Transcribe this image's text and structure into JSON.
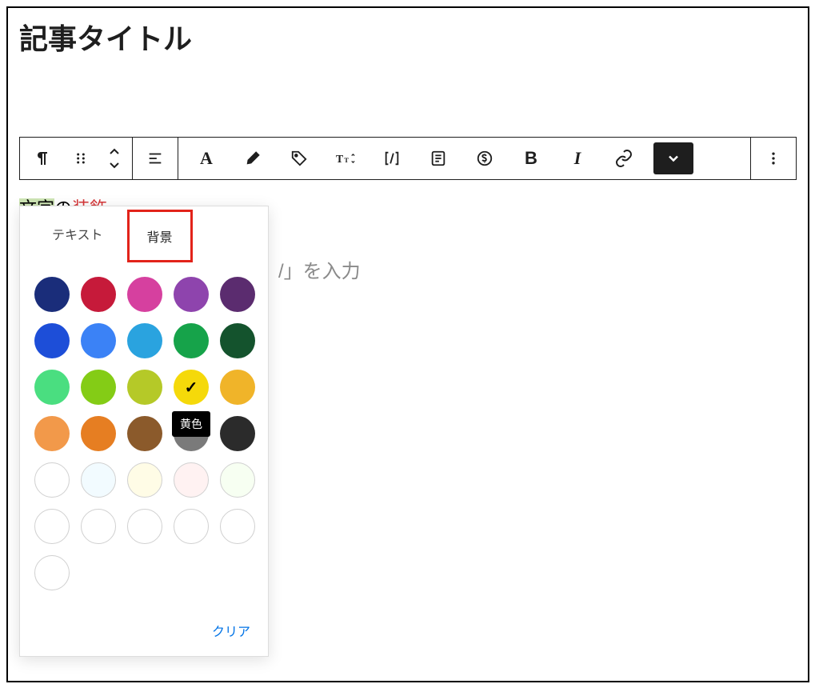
{
  "title": "記事タイトル",
  "content": {
    "highlighted": "文字",
    "plain1": "の",
    "red": "装飾"
  },
  "placeholder_fragment": "/」を入力",
  "popover": {
    "tabs": {
      "text": "テキスト",
      "background": "背景"
    },
    "tooltip": "黄色",
    "clear": "クリア",
    "colors_row1": [
      "#1a2d7a",
      "#c61a3a",
      "#d6409f",
      "#8e44ad",
      "#5b2c6f"
    ],
    "colors_row2": [
      "#1d4ed8",
      "#3b82f6",
      "#2aa3df",
      "#16a34a",
      "#14532d"
    ],
    "colors_row3": [
      "#4ade80",
      "#84cc16",
      "#b5c928",
      "#f5d90a",
      "#f0b429"
    ],
    "colors_row4": [
      "#f2994a",
      "#e67e22",
      "#8b5a2b",
      "",
      "#2b2b2b"
    ],
    "colors_row5_light": [
      "#ffffff",
      "#f2fbff",
      "#fffce6",
      "#fff2f2",
      "#f7fff2"
    ]
  }
}
